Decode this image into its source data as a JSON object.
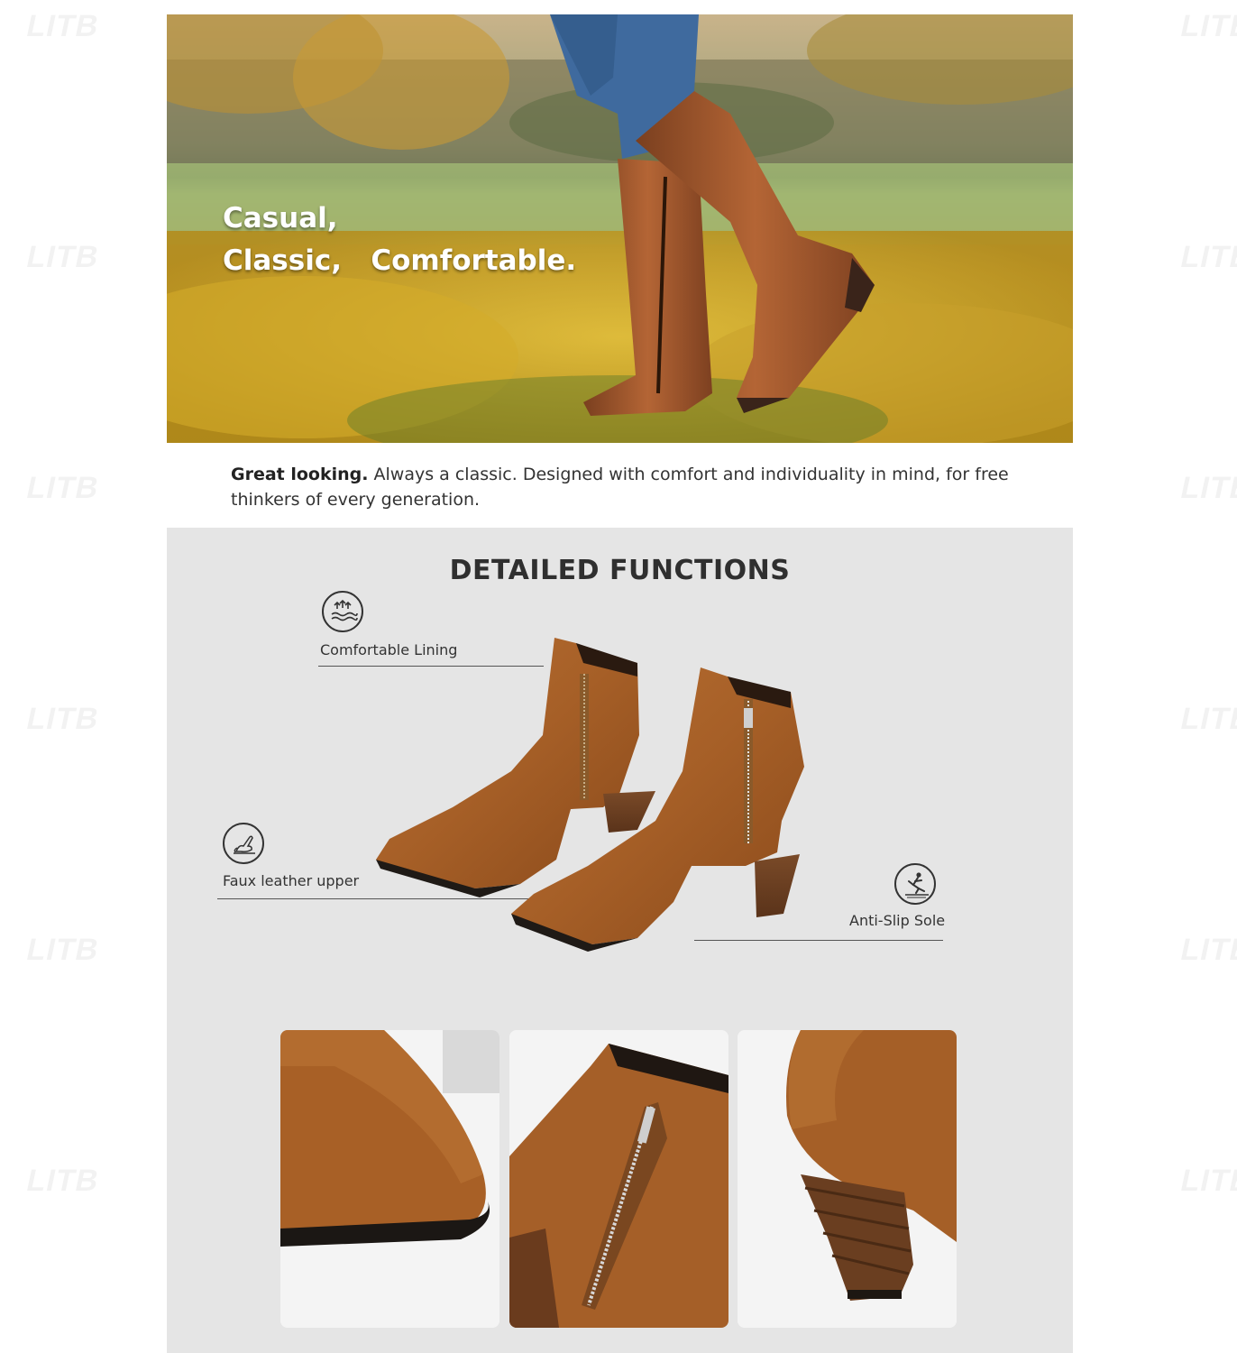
{
  "hero": {
    "line1": "Casual,",
    "line2": "Classic,   Comfortable."
  },
  "tagline": {
    "bold": "Great looking.",
    "text": " Always a classic. Designed with comfort and individuality in mind, for free thinkers of every generation."
  },
  "functions": {
    "title": "DETAILED FUNCTIONS",
    "features": [
      {
        "label": "Comfortable Lining",
        "icon": "wave-lining-icon"
      },
      {
        "label": "Faux leather upper",
        "icon": "hand-leather-icon"
      },
      {
        "label": "Anti-Slip Sole",
        "icon": "anti-slip-icon"
      }
    ]
  },
  "details": [
    {
      "name": "toe-closeup"
    },
    {
      "name": "zipper-closeup"
    },
    {
      "name": "heel-closeup"
    }
  ],
  "watermark": "LITB",
  "colors": {
    "panel_bg": "#e5e5e5",
    "leather": "#a9602a",
    "title": "#2f2f2f"
  }
}
